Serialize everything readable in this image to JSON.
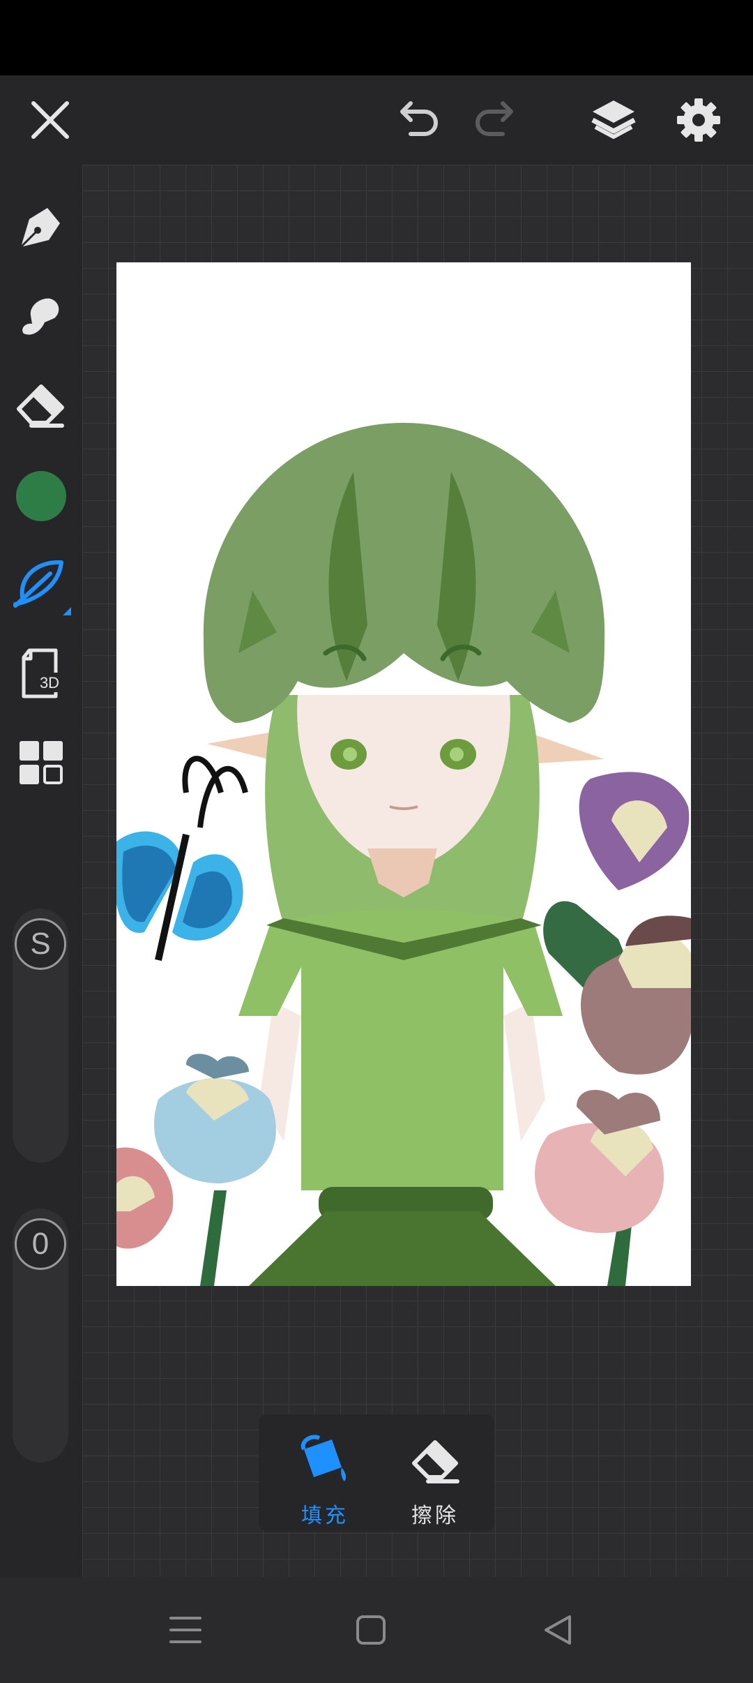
{
  "app": {
    "accent_color": "#1e90ff",
    "current_color": "#2f7d46"
  },
  "topbar": {
    "close_icon": "close-icon",
    "undo_icon": "undo-icon",
    "redo_icon": "redo-icon",
    "layers_icon": "layers-icon",
    "settings_icon": "gear-icon"
  },
  "sidebar": {
    "tools": [
      {
        "name": "pen",
        "icon": "pen-nib-icon"
      },
      {
        "name": "smudge",
        "icon": "smudge-icon"
      },
      {
        "name": "eraser",
        "icon": "eraser-icon"
      },
      {
        "name": "color",
        "icon": "color-swatch"
      },
      {
        "name": "leaf-brush",
        "icon": "leaf-icon",
        "active": true
      },
      {
        "name": "3d",
        "icon": "3d-file-icon"
      },
      {
        "name": "gallery",
        "icon": "grid-icon"
      }
    ],
    "size_label": "S",
    "opacity_label": "0"
  },
  "fill_panel": {
    "fill_label": "填充",
    "erase_label": "擦除"
  },
  "navbar": {
    "menu_icon": "menu-icon",
    "home_icon": "home-icon",
    "back_icon": "back-icon"
  }
}
